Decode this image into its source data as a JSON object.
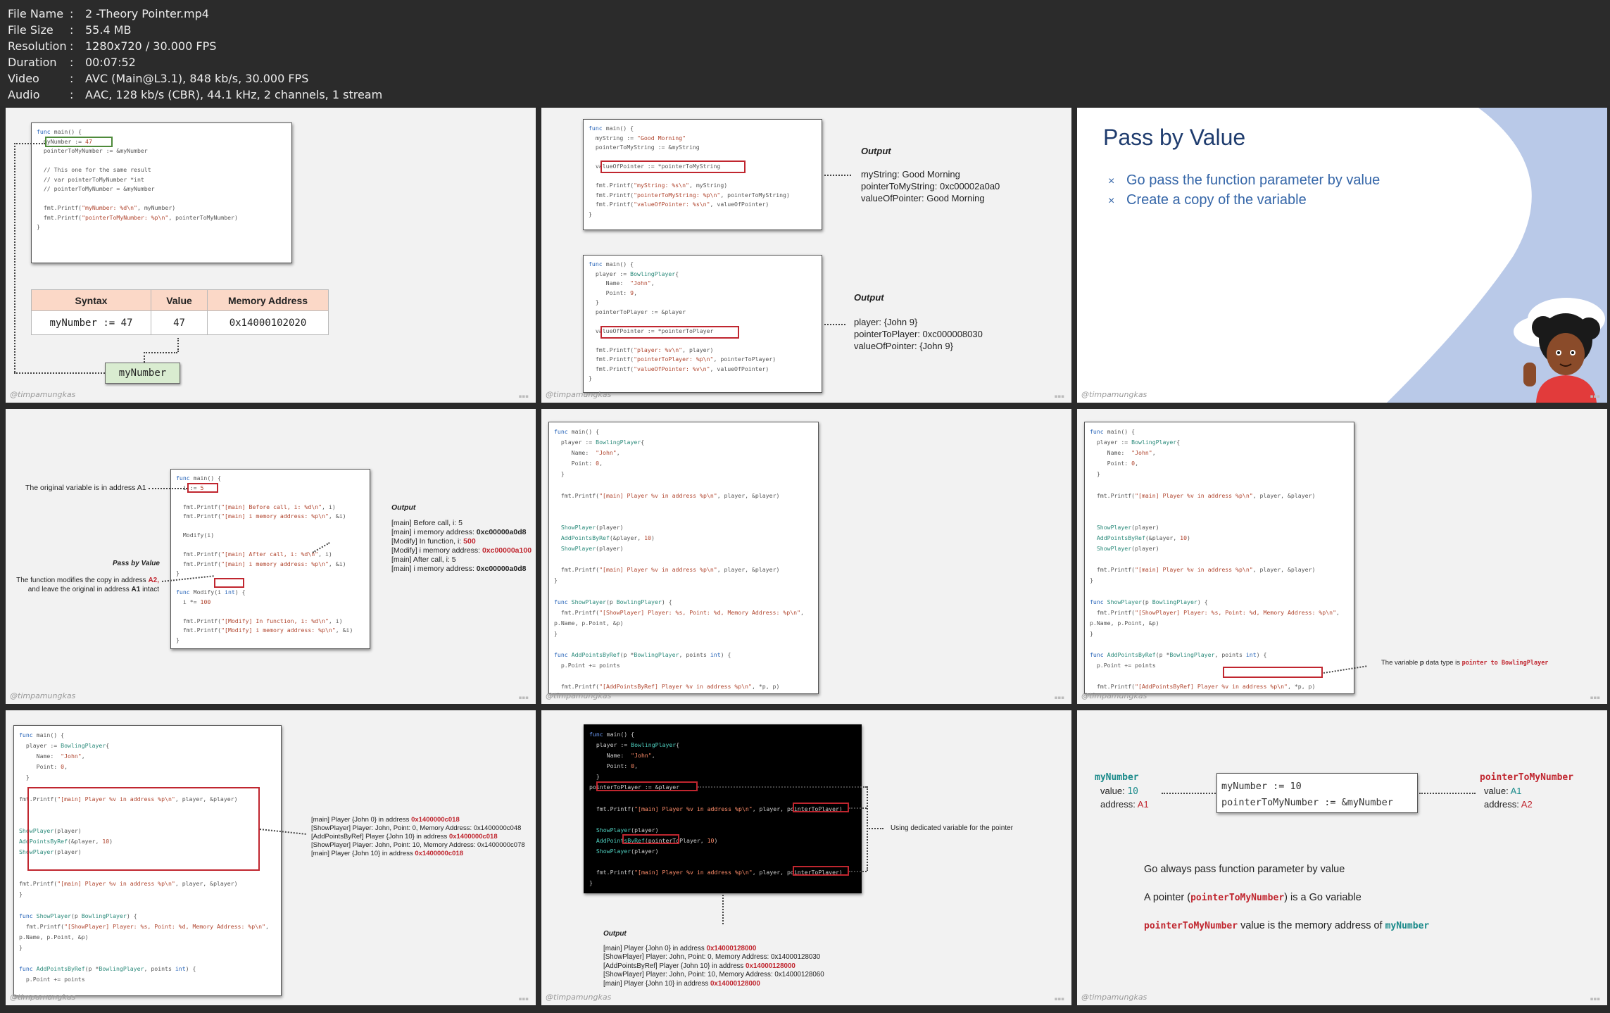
{
  "media_info": {
    "rows": [
      {
        "key": "File Name",
        "value": "2 -Theory Pointer.mp4"
      },
      {
        "key": "File Size",
        "value": "55.4 MB"
      },
      {
        "key": "Resolution",
        "value": "1280x720 / 30.000 FPS"
      },
      {
        "key": "Duration",
        "value": "00:07:52"
      },
      {
        "key": "Video",
        "value": "AVC (Main@L3.1), 848 kb/s, 30.000 FPS"
      },
      {
        "key": "Audio",
        "value": "AAC, 128 kb/s (CBR), 44.1 kHz, 2 channels, 1 stream"
      }
    ]
  },
  "watermark": "@timpamungkas",
  "tile1": {
    "table_headers": [
      "Syntax",
      "Value",
      "Memory Address"
    ],
    "table_row": [
      "myNumber := 47",
      "47",
      "0x14000102020"
    ],
    "var_label": "myNumber"
  },
  "tile2": {
    "output1_title": "Output",
    "output1": [
      "myString: Good Morning",
      "pointerToMyString: 0xc00002a0a0",
      "valueOfPointer: Good Morning"
    ],
    "output2_title": "Output",
    "output2": [
      "player: {John 9}",
      "pointerToPlayer: 0xc000008030",
      "valueOfPointer: {John 9}"
    ]
  },
  "tile3": {
    "title": "Pass by Value",
    "bullets": [
      "Go pass the function parameter by value",
      "Create a copy of the variable"
    ],
    "bullet_glyph": "×"
  },
  "tile4": {
    "note1": "The original variable is in address A1",
    "pass_label": "Pass by Value",
    "note2_a": "The function modifies the copy in address",
    "note2_b": "A2,",
    "note2_c": "and leave the original in address",
    "note2_d": "A1",
    "note2_e": "intact",
    "output_title": "Output",
    "output": [
      {
        "t": "[main] Before call, i: 5",
        "v": ""
      },
      {
        "t": "[main] i memory address: ",
        "v": "0xc00000a0d8",
        "bold": true
      },
      {
        "t": "[Modify] In function, i: ",
        "v": "500",
        "red": true
      },
      {
        "t": "[Modify] i memory address: ",
        "v": "0xc00000a100",
        "red": true
      },
      {
        "t": "[main] After call, i: 5",
        "v": ""
      },
      {
        "t": "[main] i memory address: ",
        "v": "0xc00000a0d8",
        "bold": true
      }
    ]
  },
  "tile6": {
    "note_a": "The variable",
    "note_b": "p",
    "note_c": "data type is",
    "note_d": "pointer to BowlingPlayer"
  },
  "tile7": {
    "output": [
      {
        "t": "[main] Player {John 0} in address ",
        "v": "0x1400000c018"
      },
      {
        "t": "[ShowPlayer] Player: John, Point: 0, Memory Address: 0x1400000c048",
        "v": ""
      },
      {
        "t": "[AddPointsByRef] Player {John 10} in address ",
        "v": "0x1400000c018"
      },
      {
        "t": "[ShowPlayer] Player: John, Point: 10, Memory Address: 0x1400000c078",
        "v": ""
      },
      {
        "t": "[main] Player {John 10} in address ",
        "v": "0x1400000c018"
      }
    ]
  },
  "tile8": {
    "note": "Using dedicated variable for the pointer",
    "output_title": "Output",
    "output": [
      {
        "t": "[main] Player {John 0} in address ",
        "v": "0x14000128000"
      },
      {
        "t": "[ShowPlayer] Player: John, Point: 0, Memory Address: 0x14000128030",
        "v": ""
      },
      {
        "t": "[AddPointsByRef] Player {John 10} in address ",
        "v": "0x14000128000"
      },
      {
        "t": "[ShowPlayer] Player: John, Point: 10, Memory Address: 0x14000128060",
        "v": ""
      },
      {
        "t": "[main] Player {John 10} in address ",
        "v": "0x14000128000"
      }
    ]
  },
  "tile9": {
    "left_name": "myNumber",
    "left_value_label": "value:",
    "left_value": "10",
    "left_addr_label": "address:",
    "left_addr": "A1",
    "code_line1": "myNumber := 10",
    "code_line2": "pointerToMyNumber := &myNumber",
    "right_name": "pointerToMyNumber",
    "right_value_label": "value:",
    "right_value": "A1",
    "right_addr_label": "address:",
    "right_addr": "A2",
    "s1": "Go always pass function parameter by value",
    "s2_a": "A pointer (",
    "s2_b": "pointerToMyNumber",
    "s2_c": ") is a Go variable",
    "s3_a": "pointerToMyNumber",
    "s3_b": "value is the memory address of",
    "s3_c": "myNumber"
  },
  "colors": {
    "accent_red": "#c0262f",
    "title_blue": "#1f3c6e",
    "bullet_blue": "#3566a8",
    "table_header": "#fbd8c7"
  }
}
